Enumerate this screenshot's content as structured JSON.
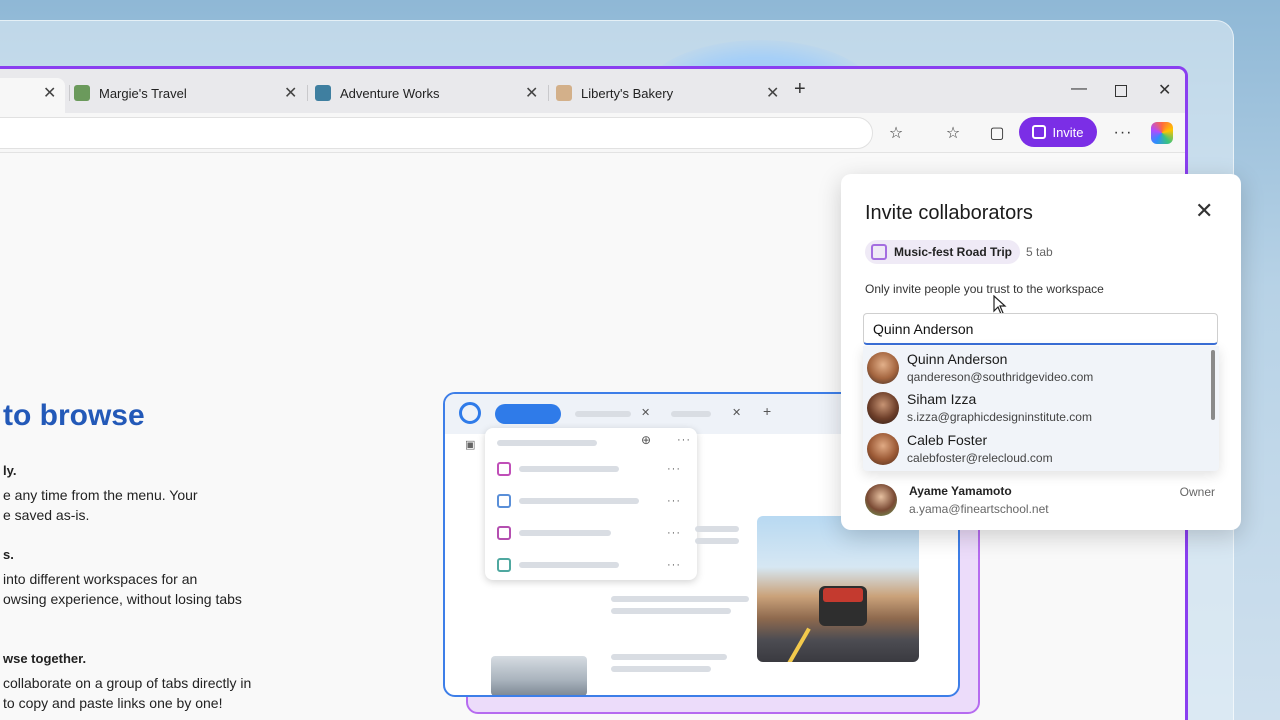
{
  "tabs": [
    {
      "label": "",
      "color": "#e9e9ec"
    },
    {
      "label": "Margie's Travel",
      "color": "#6b9a5c"
    },
    {
      "label": "Adventure Works",
      "color": "#3f7fa0"
    },
    {
      "label": "Liberty's Bakery",
      "color": "#d3b08a"
    }
  ],
  "toolbar": {
    "invite_label": "Invite",
    "accent": "#7b2ee6"
  },
  "page": {
    "hero_title": "to browse",
    "p1_bold": "ly.",
    "p1_line1": "e any time from the       menu. Your",
    "p1_line2": "e saved as-is.",
    "p2_bold": "s.",
    "p2_line1": " into different workspaces for an",
    "p2_line2": "owsing experience, without losing tabs",
    "p3_bold": "wse together.",
    "p3_line1": " collaborate on a group of tabs directly in",
    "p3_line2": "to copy and paste links one by one!"
  },
  "invite_panel": {
    "title": "Invite collaborators",
    "workspace_name": "Music-fest Road Trip",
    "workspace_count": "5 tab",
    "hint": "Only invite people you trust to the workspace",
    "input_value": "Quinn Anderson",
    "suggestions": [
      {
        "name": "Quinn Anderson",
        "email": "qandereson@southridgevideo.com"
      },
      {
        "name": "Siham Izza",
        "email": "s.izza@graphicdesigninstitute.com"
      },
      {
        "name": "Caleb Foster",
        "email": "calebfoster@relecloud.com"
      }
    ],
    "owner": {
      "name": "Ayame Yamamoto",
      "email": "a.yama@fineartschool.net",
      "role": "Owner"
    }
  }
}
